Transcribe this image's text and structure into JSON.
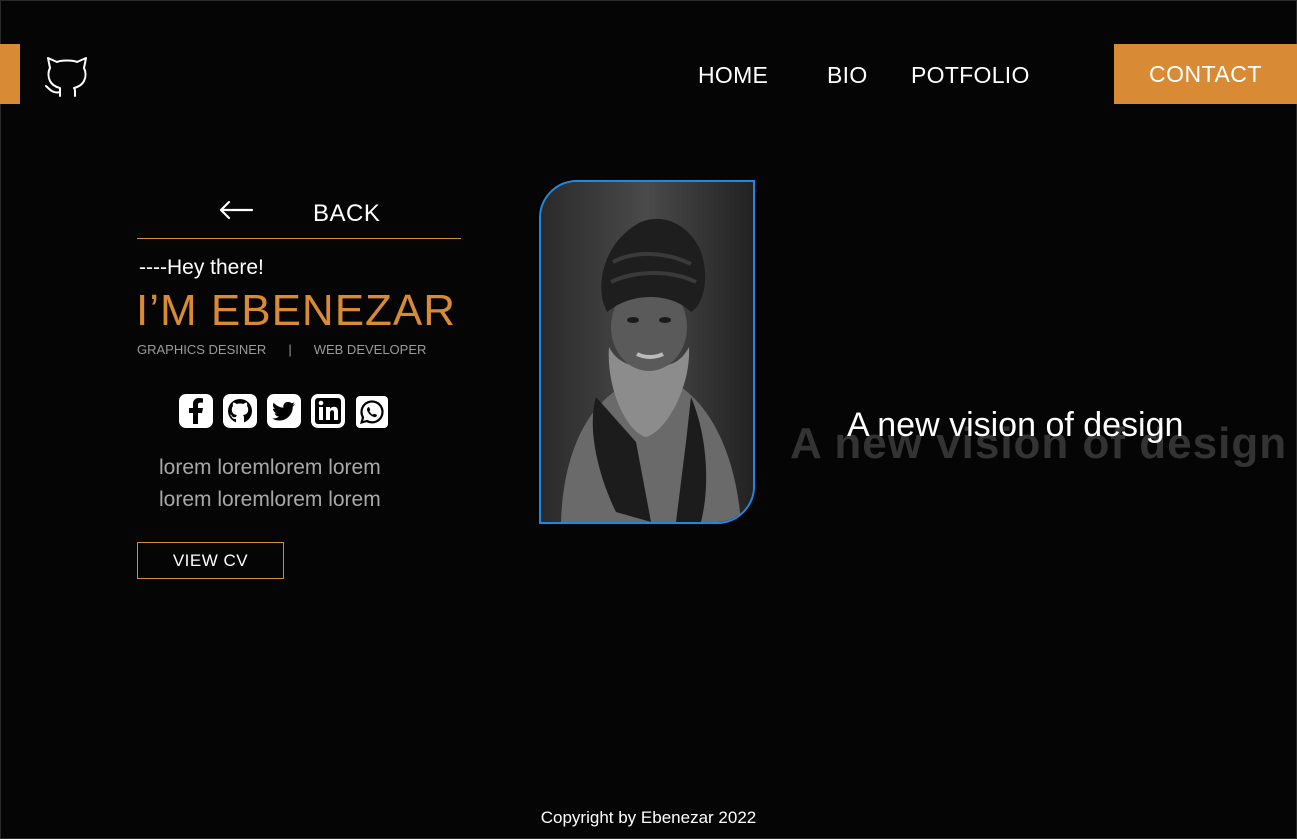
{
  "nav": {
    "home": "HOME",
    "bio": "BIO",
    "portfolio": "POTFOLIO",
    "contact": "CONTACT"
  },
  "hero": {
    "back_label": "BACK",
    "greeting": "----Hey there!",
    "name": "I’M EBENEZAR",
    "role_1": "GRAPHICS DESINER",
    "role_separator": "|",
    "role_2": "WEB DEVELOPER",
    "bio_line_1": "lorem loremlorem lorem",
    "bio_line_2": "lorem loremlorem lorem",
    "view_cv": "VIEW CV"
  },
  "socials": [
    "facebook-icon",
    "github-icon",
    "twitter-icon",
    "linkedin-icon",
    "whatsapp-icon"
  ],
  "tagline": {
    "text": "A new vision of design",
    "shadow_text": "A new vision of design"
  },
  "footer": {
    "copyright": "Copyright by Ebenezar 2022"
  },
  "colors": {
    "accent": "#d88a34",
    "background": "#050505",
    "photo_border": "#1e88e5"
  }
}
